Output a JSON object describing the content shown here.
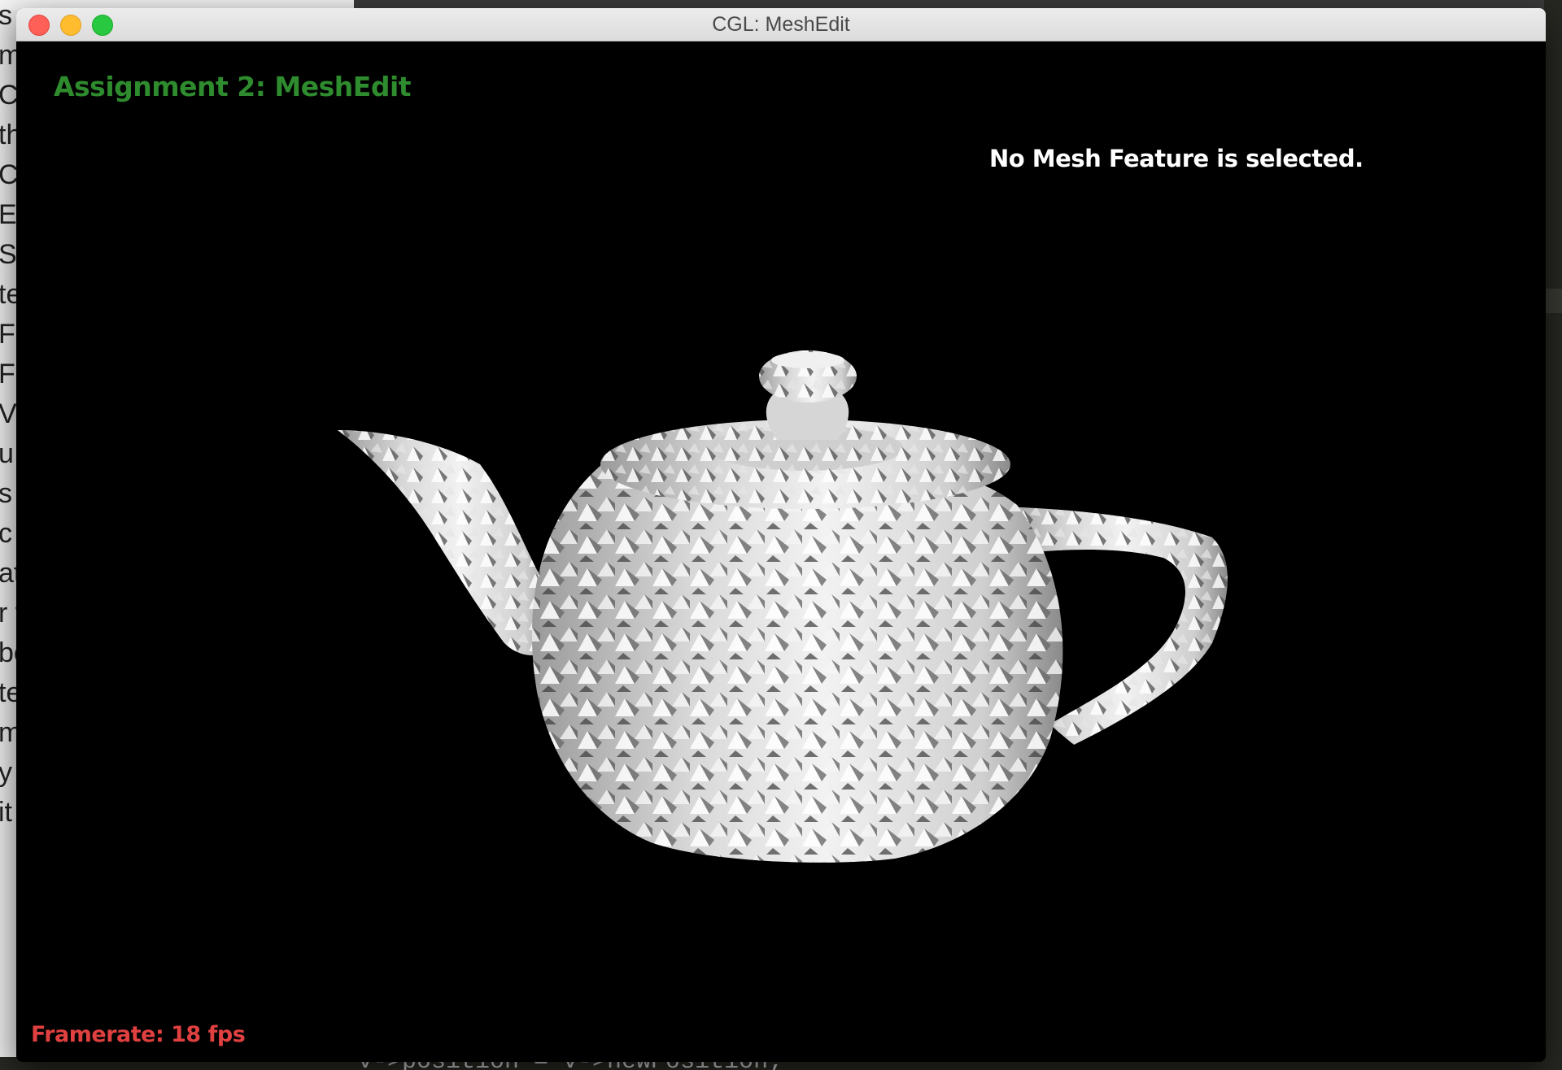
{
  "window": {
    "title": "CGL: MeshEdit"
  },
  "app": {
    "heading": "Assignment 2: MeshEdit",
    "selection_status": "No Mesh Feature is selected.",
    "framerate": "Framerate: 18 fps"
  },
  "colors": {
    "heading": "#2e8b2e",
    "framerate": "#e04040",
    "status": "#ffffff",
    "viewport_bg": "#000000"
  },
  "background": {
    "code_line": "v->position = v->newPosition;",
    "left_fragments": [
      "s",
      "m",
      "C",
      "th",
      "C",
      "E",
      "Sp",
      "te",
      "Fl",
      "Fi",
      "V",
      "u r",
      "s",
      "c",
      "at",
      "r v",
      "bo",
      "te",
      "m",
      "y a",
      "it"
    ]
  }
}
